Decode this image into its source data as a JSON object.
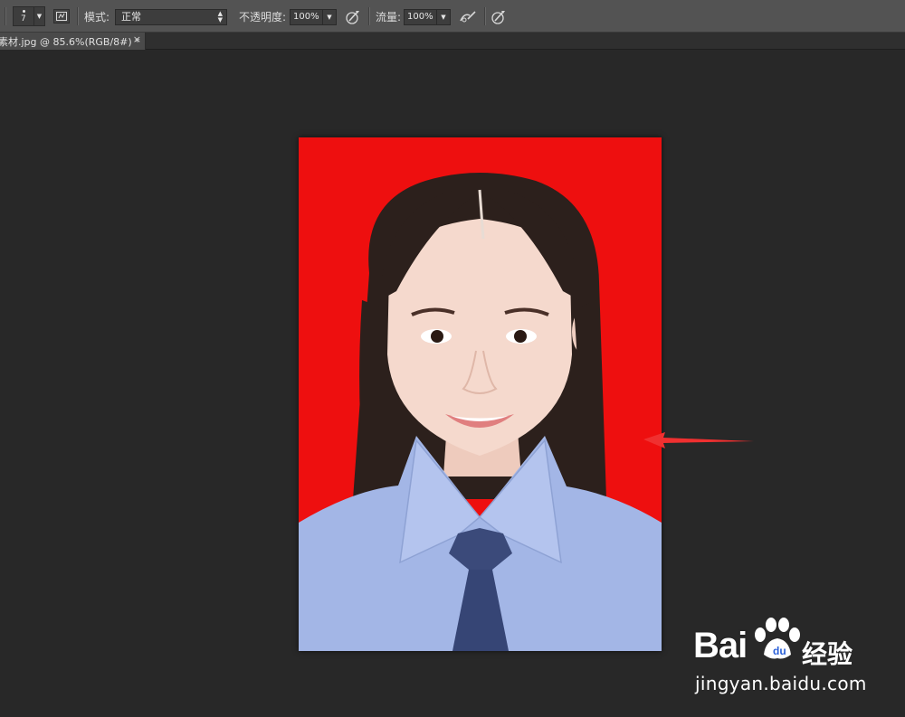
{
  "options_bar": {
    "brush_size": "7",
    "mode_label": "模式:",
    "mode_value": "正常",
    "opacity_label": "不透明度:",
    "opacity_value": "100%",
    "flow_label": "流量:",
    "flow_value": "100%"
  },
  "document_tab": {
    "title": "素材.jpg @ 85.6%(RGB/8#) *",
    "close_glyph": "×"
  },
  "colors": {
    "ui_background": "#282828",
    "options_bar": "#535353",
    "photo_background": "#ee0f0f",
    "shirt": "#a3b6e6",
    "tie": "#3b4a7a",
    "annotation_arrow": "#f03030"
  },
  "watermark": {
    "brand": "Bai",
    "brand_cn": "经验",
    "url": "jingyan.baidu.com"
  }
}
